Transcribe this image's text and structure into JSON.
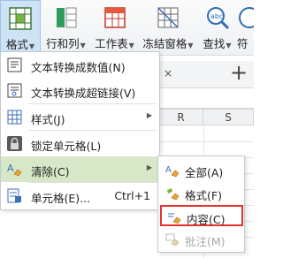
{
  "toolbar": {
    "items": [
      {
        "label": "格式",
        "icon": "format-grid-icon"
      },
      {
        "label": "行和列",
        "icon": "rows-cols-icon"
      },
      {
        "label": "工作表",
        "icon": "worksheet-icon"
      },
      {
        "label": "冻结窗格",
        "icon": "freeze-panes-icon"
      },
      {
        "label": "查找",
        "icon": "find-icon"
      },
      {
        "label": "符",
        "icon": "symbol-icon"
      }
    ]
  },
  "sheet": {
    "tab_close": "×",
    "tab_add": "+",
    "columns": [
      "R",
      "S"
    ]
  },
  "menu": {
    "items": [
      {
        "label": "文本转换成数值(N)",
        "icon": "convert-to-number-icon"
      },
      {
        "label": "文本转换成超链接(V)",
        "icon": "convert-to-hyperlink-icon"
      },
      {
        "label": "样式(J)",
        "icon": "style-icon",
        "submenu": true
      },
      {
        "label": "锁定单元格(L)",
        "icon": "lock-icon"
      },
      {
        "label": "清除(C)",
        "icon": "eraser-icon",
        "submenu": true
      },
      {
        "label": "单元格(E)...",
        "icon": "cell-format-icon",
        "shortcut": "Ctrl+1"
      }
    ]
  },
  "submenu": {
    "items": [
      {
        "label": "全部(A)",
        "icon": "clear-all-icon"
      },
      {
        "label": "格式(F)",
        "icon": "clear-format-icon"
      },
      {
        "label": "内容(C)",
        "icon": "clear-content-icon",
        "highlighted": true
      },
      {
        "label": "批注(M)",
        "icon": "clear-comment-icon",
        "disabled": true
      }
    ]
  },
  "colors": {
    "hover": "#d6e8c7",
    "highlight_border": "#e0332f",
    "active_tool": "#cfe3f7"
  }
}
